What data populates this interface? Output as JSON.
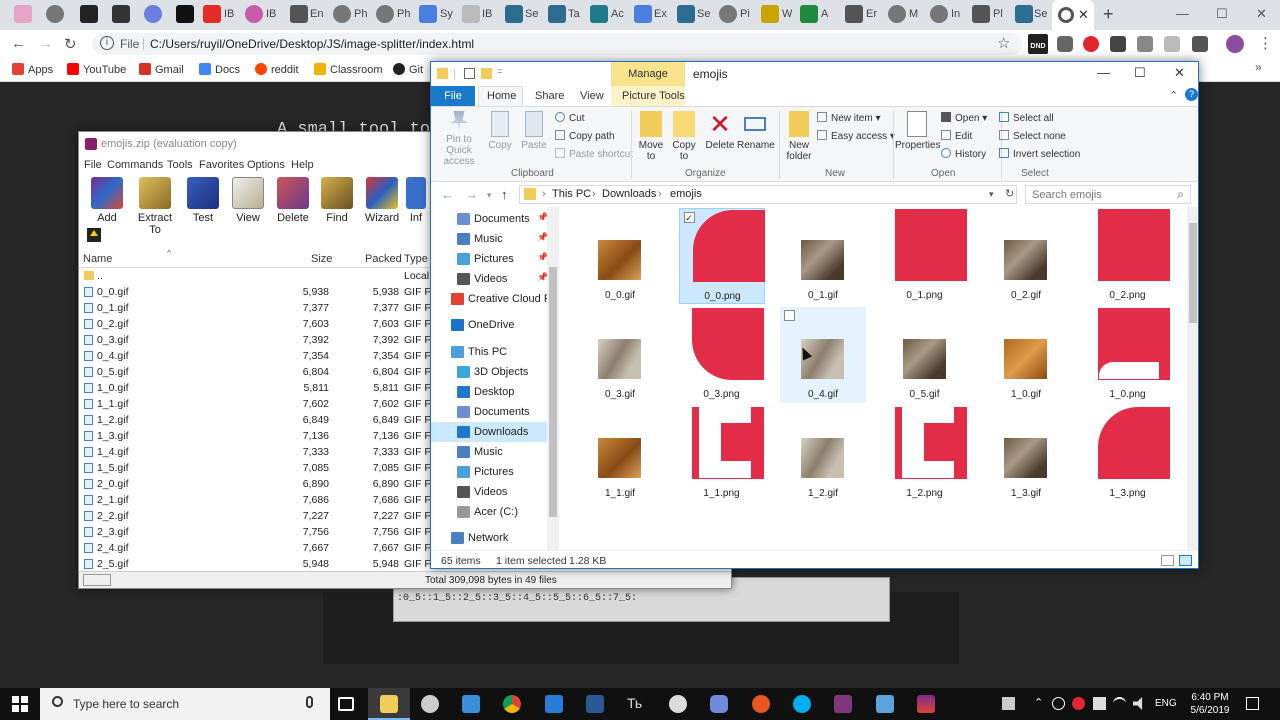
{
  "browser": {
    "tabs": [
      "IB",
      "IB",
      "IB",
      "En",
      "Ph",
      "Ph",
      "Sy",
      "IB",
      "Se",
      "Ta",
      "Ac",
      "Ex",
      "Se",
      "Pi",
      "W",
      "A",
      "Er",
      "M",
      "In",
      "Pl",
      "Se"
    ],
    "url_scheme": "File",
    "url": "C:/Users/ruyil/OneDrive/Desktop/JS/image-splitter/index.html",
    "dnd_badge": "DND",
    "bookmarks": [
      "Apps",
      "YouTube",
      "Gmail",
      "Docs",
      "reddit",
      "Classroom",
      "Git"
    ]
  },
  "page": {
    "title": "A small tool to",
    "textarea_value": ":0_5::1_5::2_5::3_5::4_5::5_5::6_5::7_5:"
  },
  "winrar": {
    "title": "emojis.zip (evaluation copy)",
    "menu": [
      "File",
      "Commands",
      "Tools",
      "Favorites",
      "Options",
      "Help"
    ],
    "toolbar": [
      "Add",
      "Extract To",
      "Test",
      "View",
      "Delete",
      "Find",
      "Wizard",
      "Inf"
    ],
    "columns": [
      "Name",
      "Size",
      "Packed",
      "Type"
    ],
    "parent_row": {
      "name": "..",
      "type": "Local"
    },
    "files": [
      {
        "name": "0_0.gif",
        "size": "5,938",
        "packed": "5,938",
        "type": "GIF Fil"
      },
      {
        "name": "0_1.gif",
        "size": "7,377",
        "packed": "7,377",
        "type": "GIF Fil"
      },
      {
        "name": "0_2.gif",
        "size": "7,603",
        "packed": "7,603",
        "type": "GIF Fil"
      },
      {
        "name": "0_3.gif",
        "size": "7,392",
        "packed": "7,392",
        "type": "GIF Fil"
      },
      {
        "name": "0_4.gif",
        "size": "7,354",
        "packed": "7,354",
        "type": "GIF Fil"
      },
      {
        "name": "0_5.gif",
        "size": "6,804",
        "packed": "6,804",
        "type": "GIF Fil"
      },
      {
        "name": "1_0.gif",
        "size": "5,811",
        "packed": "5,811",
        "type": "GIF Fil"
      },
      {
        "name": "1_1.gif",
        "size": "7,602",
        "packed": "7,602",
        "type": "GIF Fil"
      },
      {
        "name": "1_2.gif",
        "size": "6,849",
        "packed": "6,849",
        "type": "GIF Fil"
      },
      {
        "name": "1_3.gif",
        "size": "7,136",
        "packed": "7,136",
        "type": "GIF Fil"
      },
      {
        "name": "1_4.gif",
        "size": "7,333",
        "packed": "7,333",
        "type": "GIF Fil"
      },
      {
        "name": "1_5.gif",
        "size": "7,085",
        "packed": "7,085",
        "type": "GIF Fil"
      },
      {
        "name": "2_0.gif",
        "size": "6,890",
        "packed": "6,890",
        "type": "GIF Fil"
      },
      {
        "name": "2_1.gif",
        "size": "7,686",
        "packed": "7,686",
        "type": "GIF Fil"
      },
      {
        "name": "2_2.gif",
        "size": "7,227",
        "packed": "7,227",
        "type": "GIF Fil"
      },
      {
        "name": "2_3.gif",
        "size": "7,756",
        "packed": "7,756",
        "type": "GIF Fil"
      },
      {
        "name": "2_4.gif",
        "size": "7,667",
        "packed": "7,667",
        "type": "GIF Fil"
      },
      {
        "name": "2_5.gif",
        "size": "5,948",
        "packed": "5,948",
        "type": "GIF Fil"
      }
    ],
    "status": "Total 309,098 bytes in 49 files"
  },
  "explorer": {
    "manage_label": "Manage",
    "window_title": "emojis",
    "tabs": [
      "File",
      "Home",
      "Share",
      "View",
      "Picture Tools"
    ],
    "ribbon": {
      "pin": "Pin to Quick access",
      "copy": "Copy",
      "paste": "Paste",
      "cut": "Cut",
      "copy_path": "Copy path",
      "paste_shortcut": "Paste shortcut",
      "move_to": "Move to",
      "copy_to": "Copy to",
      "delete": "Delete",
      "rename": "Rename",
      "new_folder": "New folder",
      "new_item": "New item",
      "easy_access": "Easy access",
      "properties": "Properties",
      "open": "Open",
      "edit": "Edit",
      "history": "History",
      "select_all": "Select all",
      "select_none": "Select none",
      "invert_selection": "Invert selection",
      "groups": [
        "Clipboard",
        "Organize",
        "New",
        "Open",
        "Select"
      ]
    },
    "breadcrumb": [
      "This PC",
      "Downloads",
      "emojis"
    ],
    "search_placeholder": "Search emojis",
    "nav": [
      "Documents",
      "Music",
      "Pictures",
      "Videos",
      "Creative Cloud Files",
      "OneDrive",
      "This PC",
      "3D Objects",
      "Desktop",
      "Documents",
      "Downloads",
      "Music",
      "Pictures",
      "Videos",
      "Acer (C:)",
      "Network"
    ],
    "files": [
      "0_0.gif",
      "0_0.png",
      "0_1.gif",
      "0_1.png",
      "0_2.gif",
      "0_2.png",
      "0_3.gif",
      "0_3.png",
      "0_4.gif",
      "0_5.gif",
      "1_0.gif",
      "1_0.png",
      "1_1.gif",
      "1_1.png",
      "1_2.gif",
      "1_2.png",
      "1_3.gif",
      "1_3.png"
    ],
    "status_items": "65 items",
    "status_selected": "1 item selected",
    "status_size": "1.28 KB",
    "accent_color": "#1979ca",
    "emoji_red": "#e32c48"
  },
  "taskbar": {
    "search_placeholder": "Type here to search",
    "lang": "ENG",
    "time": "6:40 PM",
    "date": "5/6/2019"
  }
}
